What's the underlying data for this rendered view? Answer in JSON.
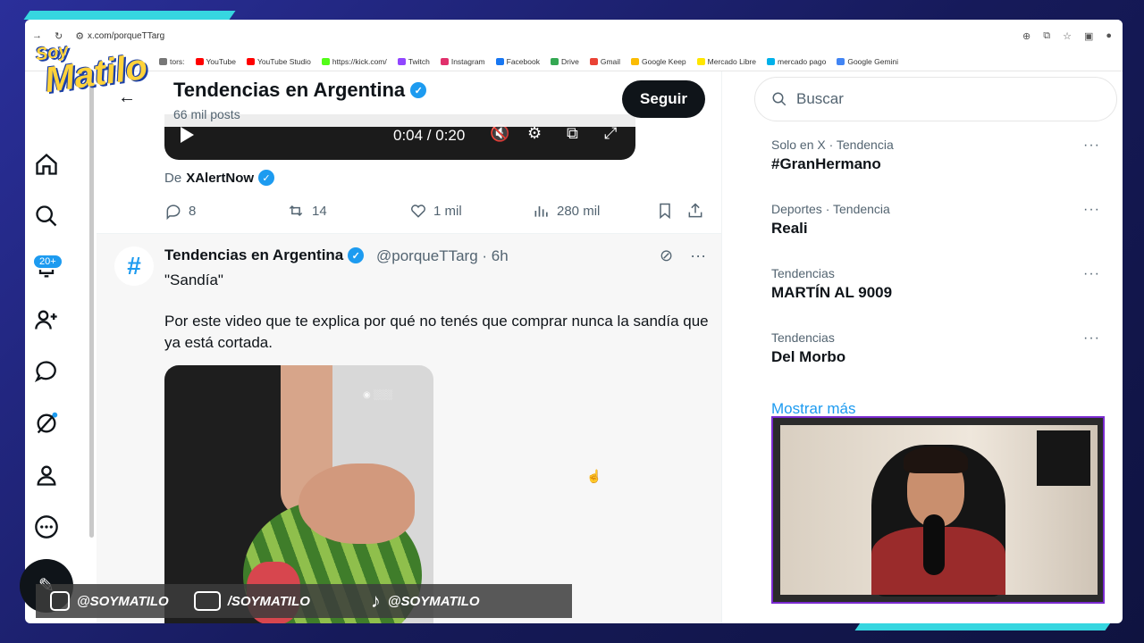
{
  "browser": {
    "url": "x.com/porqueTTarg",
    "bookmarks": [
      "tors:",
      "YouTube",
      "YouTube Studio",
      "https://kick.com/",
      "Twitch",
      "Instagram",
      "Facebook",
      "Drive",
      "Gmail",
      "Google Keep",
      "Mercado Libre",
      "mercado pago",
      "Google Gemini"
    ],
    "bookmark_colors": [
      "#777777",
      "#ff0000",
      "#ff0000",
      "#53fc18",
      "#9146ff",
      "#e1306c",
      "#1877f2",
      "#34a853",
      "#ea4335",
      "#fbbc04",
      "#ffe600",
      "#00b1ea",
      "#4285f4"
    ]
  },
  "nav": {
    "badge": "20+"
  },
  "header": {
    "back_icon": "arrow-left-icon",
    "title": "Tendencias en Argentina",
    "subtitle": "66 mil posts",
    "follow_label": "Seguir"
  },
  "prev_post": {
    "video_time": "0:04 / 0:20",
    "from_label": "De",
    "from_user": "XAlertNow",
    "stats": {
      "replies": "8",
      "reposts": "14",
      "likes": "1 mil",
      "views": "280 mil"
    }
  },
  "post": {
    "name": "Tendencias en Argentina",
    "handle": "@porqueTTarg · 6h",
    "quote": "\"Sandía\"",
    "text": "Por este video que te explica por qué no tenés que comprar nunca la sandía que ya está cortada.",
    "avatar_symbol": "#"
  },
  "search": {
    "placeholder": "Buscar"
  },
  "trends": [
    {
      "category": "Solo en X · Tendencia",
      "name": "#GranHermano"
    },
    {
      "category": "Deportes · Tendencia",
      "name": "Reali"
    },
    {
      "category": "Tendencias",
      "name": "MARTÍN AL 9009"
    },
    {
      "category": "Tendencias",
      "name": "Del Morbo"
    }
  ],
  "show_more": "Mostrar más",
  "overlay": {
    "logo_line1": "Soy",
    "logo_line2": "Matilo",
    "socials": [
      "@SOYMATILO",
      "/SOYMATILO",
      "@SOYMATILO"
    ]
  },
  "colors": {
    "accent": "#1d9bf0",
    "frame": "#36d6e0",
    "text": "#0f1419"
  }
}
